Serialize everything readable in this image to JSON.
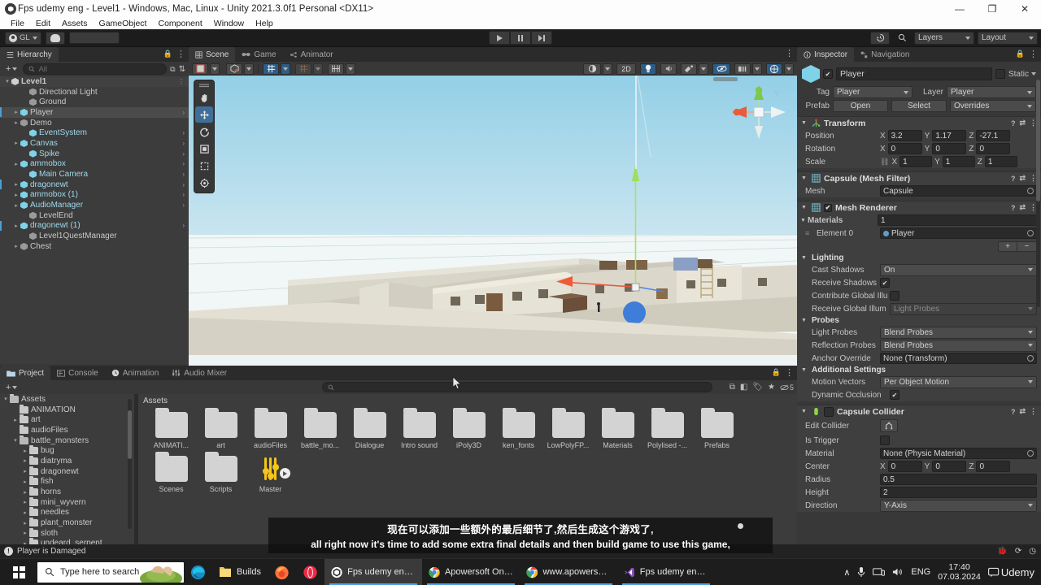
{
  "window": {
    "title": "Fps udemy eng - Level1 - Windows, Mac, Linux - Unity 2021.3.0f1 Personal <DX11>",
    "minimize": "—",
    "maximize": "❐",
    "close": "✕"
  },
  "menubar": {
    "items": [
      "File",
      "Edit",
      "Assets",
      "GameObject",
      "Component",
      "Window",
      "Help"
    ]
  },
  "toolbar": {
    "account_label": "GL",
    "layers_label": "Layers",
    "layout_label": "Layout",
    "play": "play-icon",
    "pause": "pause-icon",
    "step": "step-icon",
    "history": "history-icon",
    "search": "search-icon",
    "cloud": "cloud-icon"
  },
  "hierarchy": {
    "tab": "Hierarchy",
    "search_placeholder": "All",
    "add_label": "+",
    "items": [
      {
        "label": "Level1",
        "depth": 0,
        "arrow": "▾",
        "icon": "scene-icon",
        "style": "root",
        "chevron": false,
        "prefab": false
      },
      {
        "label": "Directional Light",
        "depth": 2,
        "arrow": "",
        "icon": "gameobject-icon",
        "style": "plain",
        "chevron": false,
        "prefab": false
      },
      {
        "label": "Ground",
        "depth": 2,
        "arrow": "",
        "icon": "gameobject-icon",
        "style": "plain",
        "chevron": false,
        "prefab": false
      },
      {
        "label": "Player",
        "depth": 1,
        "arrow": "▸",
        "icon": "prefab-icon",
        "style": "selected",
        "chevron": true,
        "prefab": true
      },
      {
        "label": "Demo",
        "depth": 1,
        "arrow": "▸",
        "icon": "gameobject-icon",
        "style": "plain",
        "chevron": false,
        "prefab": false
      },
      {
        "label": "EventSystem",
        "depth": 2,
        "arrow": "",
        "icon": "prefab-icon",
        "style": "blue",
        "chevron": true,
        "prefab": false
      },
      {
        "label": "Canvas",
        "depth": 1,
        "arrow": "▸",
        "icon": "prefab-icon",
        "style": "blue",
        "chevron": true,
        "prefab": false
      },
      {
        "label": "Spike",
        "depth": 2,
        "arrow": "",
        "icon": "prefab-icon",
        "style": "blue",
        "chevron": true,
        "prefab": false
      },
      {
        "label": "ammobox",
        "depth": 1,
        "arrow": "▸",
        "icon": "prefab-icon",
        "style": "blue",
        "chevron": true,
        "prefab": false
      },
      {
        "label": "Main Camera",
        "depth": 2,
        "arrow": "",
        "icon": "prefab-icon",
        "style": "blue",
        "chevron": true,
        "prefab": false
      },
      {
        "label": "dragonewt",
        "depth": 1,
        "arrow": "▸",
        "icon": "prefab-icon",
        "style": "blue",
        "chevron": true,
        "prefab": true
      },
      {
        "label": "ammobox (1)",
        "depth": 1,
        "arrow": "▸",
        "icon": "prefab-icon",
        "style": "blue",
        "chevron": true,
        "prefab": false
      },
      {
        "label": "AudioManager",
        "depth": 1,
        "arrow": "▸",
        "icon": "prefab-icon",
        "style": "blue",
        "chevron": true,
        "prefab": false
      },
      {
        "label": "LevelEnd",
        "depth": 2,
        "arrow": "",
        "icon": "gameobject-icon",
        "style": "plain",
        "chevron": false,
        "prefab": false
      },
      {
        "label": "dragonewt (1)",
        "depth": 1,
        "arrow": "▸",
        "icon": "prefab-icon",
        "style": "blue",
        "chevron": true,
        "prefab": true
      },
      {
        "label": "Level1QuestManager",
        "depth": 2,
        "arrow": "",
        "icon": "gameobject-icon",
        "style": "plain",
        "chevron": false,
        "prefab": false
      },
      {
        "label": "Chest",
        "depth": 1,
        "arrow": "▸",
        "icon": "gameobject-icon",
        "style": "plain",
        "chevron": false,
        "prefab": false
      }
    ]
  },
  "scene": {
    "tabs": [
      {
        "label": "Scene",
        "icon": "grid-icon",
        "active": true
      },
      {
        "label": "Game",
        "icon": "gamepad-icon",
        "active": false
      },
      {
        "label": "Animator",
        "icon": "animator-icon",
        "active": false
      }
    ],
    "toolbar_left": [
      "shading-mode",
      "gizmo-2d-toggle",
      "lighting-toggle",
      "audio-toggle",
      "effects-toggle"
    ],
    "toolbar_right": [
      "shading-dropdown",
      "2D",
      "lighting-icon",
      "audio-icon",
      "fx-icon",
      "gizmos-icon",
      "visibility-icon",
      "camera-icon"
    ],
    "2d_label": "2D",
    "transform_tools": [
      "hand-tool",
      "move-tool",
      "rotate-tool",
      "scale-tool",
      "rect-tool",
      "transform-tool"
    ],
    "active_tool": "move-tool"
  },
  "inspector": {
    "tabs": [
      {
        "label": "Inspector",
        "icon": "info-icon",
        "active": true
      },
      {
        "label": "Navigation",
        "icon": "navigation-icon",
        "active": false
      }
    ],
    "object_name": "Player",
    "enabled": true,
    "static_label": "Static",
    "tag_label": "Tag",
    "tag_value": "Player",
    "layer_label": "Layer",
    "layer_value": "Player",
    "prefab_label": "Prefab",
    "prefab_open": "Open",
    "prefab_select": "Select",
    "prefab_overrides": "Overrides",
    "transform": {
      "title": "Transform",
      "position_label": "Position",
      "position": {
        "x": "3.2",
        "y": "1.17",
        "z": "-27.1"
      },
      "rotation_label": "Rotation",
      "rotation": {
        "x": "0",
        "y": "0",
        "z": "0"
      },
      "scale_label": "Scale",
      "scale": {
        "x": "1",
        "y": "1",
        "z": "1"
      }
    },
    "mesh_filter": {
      "title": "Capsule (Mesh Filter)",
      "mesh_label": "Mesh",
      "mesh_value": "Capsule"
    },
    "mesh_renderer": {
      "title": "Mesh Renderer",
      "enabled": true,
      "materials_label": "Materials",
      "materials_count": "1",
      "element_label": "Element 0",
      "element_value": "Player",
      "lighting_label": "Lighting",
      "cast_shadows_label": "Cast Shadows",
      "cast_shadows_value": "On",
      "receive_shadows_label": "Receive Shadows",
      "receive_shadows_checked": true,
      "contribute_gi_label": "Contribute Global Illu",
      "contribute_gi_checked": false,
      "receive_gi_label": "Receive Global Illum",
      "receive_gi_value": "Light Probes",
      "probes_label": "Probes",
      "light_probes_label": "Light Probes",
      "light_probes_value": "Blend Probes",
      "reflection_probes_label": "Reflection Probes",
      "reflection_probes_value": "Blend Probes",
      "anchor_override_label": "Anchor Override",
      "anchor_override_value": "None (Transform)",
      "additional_label": "Additional Settings",
      "motion_vectors_label": "Motion Vectors",
      "motion_vectors_value": "Per Object Motion",
      "dynamic_occlusion_label": "Dynamic Occlusion",
      "dynamic_occlusion_checked": true
    },
    "capsule_collider": {
      "title": "Capsule Collider",
      "edit_collider_label": "Edit Collider",
      "is_trigger_label": "Is Trigger",
      "is_trigger_checked": false,
      "material_label": "Material",
      "material_value": "None (Physic Material)",
      "center_label": "Center",
      "center": {
        "x": "0",
        "y": "0",
        "z": "0"
      },
      "radius_label": "Radius",
      "radius_value": "0.5",
      "height_label": "Height",
      "height_value": "2",
      "direction_label": "Direction",
      "direction_value": "Y-Axis"
    }
  },
  "project": {
    "tabs": [
      {
        "label": "Project",
        "icon": "folder-icon",
        "active": true
      },
      {
        "label": "Console",
        "icon": "console-icon",
        "active": false
      },
      {
        "label": "Animation",
        "icon": "clock-icon",
        "active": false
      },
      {
        "label": "Audio Mixer",
        "icon": "mixer-icon",
        "active": false
      }
    ],
    "add_label": "+",
    "search_placeholder": "",
    "favorites_count": "5",
    "breadcrumb": "Assets",
    "tree": [
      {
        "label": "Assets",
        "depth": 0,
        "arrow": "▾",
        "open": true
      },
      {
        "label": "ANIMATION",
        "depth": 1,
        "arrow": "",
        "open": false
      },
      {
        "label": "art",
        "depth": 1,
        "arrow": "▸",
        "open": false
      },
      {
        "label": "audioFiles",
        "depth": 1,
        "arrow": "",
        "open": false
      },
      {
        "label": "battle_monsters",
        "depth": 1,
        "arrow": "▾",
        "open": true
      },
      {
        "label": "bug",
        "depth": 2,
        "arrow": "▸",
        "open": false
      },
      {
        "label": "diatryma",
        "depth": 2,
        "arrow": "▸",
        "open": false
      },
      {
        "label": "dragonewt",
        "depth": 2,
        "arrow": "▸",
        "open": false
      },
      {
        "label": "fish",
        "depth": 2,
        "arrow": "▸",
        "open": false
      },
      {
        "label": "horns",
        "depth": 2,
        "arrow": "▸",
        "open": false
      },
      {
        "label": "mini_wyvern",
        "depth": 2,
        "arrow": "▸",
        "open": false
      },
      {
        "label": "needles",
        "depth": 2,
        "arrow": "▸",
        "open": false
      },
      {
        "label": "plant_monster",
        "depth": 2,
        "arrow": "▸",
        "open": false
      },
      {
        "label": "sloth",
        "depth": 2,
        "arrow": "▸",
        "open": false
      },
      {
        "label": "undeard_serpent",
        "depth": 2,
        "arrow": "▸",
        "open": false
      }
    ],
    "assets": [
      {
        "label": "ANIMATI...",
        "type": "folder"
      },
      {
        "label": "art",
        "type": "folder"
      },
      {
        "label": "audioFiles",
        "type": "folder"
      },
      {
        "label": "battle_mo...",
        "type": "folder"
      },
      {
        "label": "Dialogue",
        "type": "folder"
      },
      {
        "label": "Intro sound",
        "type": "folder"
      },
      {
        "label": "iPoly3D",
        "type": "folder"
      },
      {
        "label": "ken_fonts",
        "type": "folder"
      },
      {
        "label": "LowPolyFP...",
        "type": "folder"
      },
      {
        "label": "Materials",
        "type": "folder"
      },
      {
        "label": "Polylised -...",
        "type": "folder"
      },
      {
        "label": "Prefabs",
        "type": "folder"
      },
      {
        "label": "Scenes",
        "type": "folder"
      },
      {
        "label": "Scripts",
        "type": "folder"
      },
      {
        "label": "Master",
        "type": "audio-mixer"
      }
    ]
  },
  "statusbar": {
    "message": "Player is Damaged"
  },
  "subtitles": {
    "chinese": "现在可以添加一些额外的最后细节了,然后生成这个游戏了,",
    "english": "all right now it's time to add some extra final details and then build game to use this game,"
  },
  "taskbar": {
    "search_placeholder": "Type here to search",
    "items": [
      {
        "label": "Builds",
        "icon": "folder-icon",
        "active": false,
        "underline": false
      },
      {
        "label": "",
        "icon": "firefox-icon",
        "active": false,
        "underline": false
      },
      {
        "label": "",
        "icon": "opera-icon",
        "active": false,
        "underline": false
      },
      {
        "label": "Fps udemy eng - L...",
        "icon": "unity-icon",
        "active": true,
        "underline": true
      },
      {
        "label": "Apowersoft Online ...",
        "icon": "chrome-icon",
        "active": false,
        "underline": true
      },
      {
        "label": "www.apowersoft.c...",
        "icon": "chrome-icon",
        "active": false,
        "underline": true
      },
      {
        "label": "Fps udemy eng - M...",
        "icon": "vs-icon",
        "active": false,
        "underline": true
      }
    ],
    "edge_icon": "edge-icon",
    "tray": {
      "chevron": "∧",
      "mic": "mic-icon",
      "network": "network-icon",
      "volume": "volume-icon",
      "lang": "ENG"
    },
    "clock_time": "17:40",
    "clock_date": "07.03.2024",
    "notification": "notification-icon",
    "watermark": "Udemy"
  }
}
